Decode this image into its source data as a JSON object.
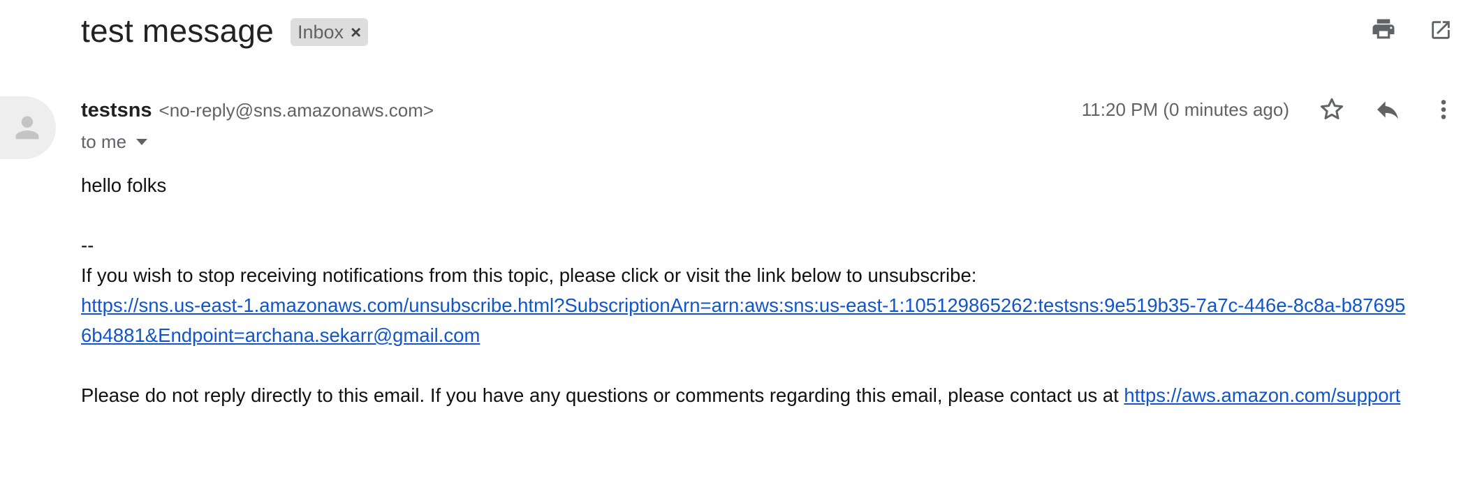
{
  "email": {
    "subject": "test message",
    "label": "Inbox",
    "label_remove": "×",
    "sender": {
      "name": "testsns",
      "email": "<no-reply@sns.amazonaws.com>"
    },
    "recipient": "to me",
    "timestamp": "11:20 PM (0 minutes ago)",
    "body": {
      "greeting": "hello folks",
      "separator": "--",
      "unsubscribe_intro": "If you wish to stop receiving notifications from this topic, please click or visit the link below to unsubscribe:",
      "unsubscribe_link": "https://sns.us-east-1.amazonaws.com/unsubscribe.html?SubscriptionArn=arn:aws:sns:us-east-1:105129865262:testsns:9e519b35-7a7c-446e-8c8a-b876956b4881&Endpoint=archana.sekarr@gmail.com",
      "footer_text": "Please do not reply directly to this email. If you have any questions or comments regarding this email, please contact us at ",
      "support_link": "https://aws.amazon.com/support"
    }
  },
  "icons": {
    "print": "print-icon",
    "open_new_window": "open-in-new-window-icon",
    "avatar": "person-avatar-icon",
    "star": "star-icon",
    "reply": "reply-icon",
    "more": "more-vertical-icon",
    "caret": "caret-down-icon"
  },
  "colors": {
    "link": "#1155cc",
    "icon": "#5f6368",
    "chip_bg": "#dddddd",
    "avatar_bg": "#eeeeee"
  }
}
